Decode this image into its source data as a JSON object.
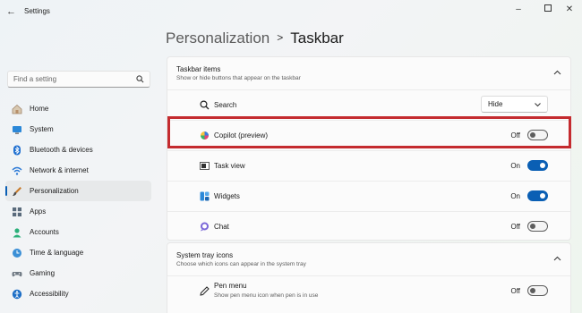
{
  "window": {
    "title": "Settings",
    "back_icon": "back-arrow-icon",
    "controls": {
      "minimize": "minimize-icon",
      "maximize": "maximize-icon",
      "close": "close-icon"
    }
  },
  "search": {
    "placeholder": "Find a setting",
    "value": "",
    "icon": "search-icon"
  },
  "sidebar": {
    "active_item": "Personalization",
    "items": [
      {
        "label": "Home",
        "icon": "home-icon"
      },
      {
        "label": "System",
        "icon": "monitor-icon"
      },
      {
        "label": "Bluetooth & devices",
        "icon": "bluetooth-icon"
      },
      {
        "label": "Network & internet",
        "icon": "wifi-icon"
      },
      {
        "label": "Personalization",
        "icon": "brush-icon"
      },
      {
        "label": "Apps",
        "icon": "apps-icon"
      },
      {
        "label": "Accounts",
        "icon": "person-icon"
      },
      {
        "label": "Time & language",
        "icon": "globe-clock-icon"
      },
      {
        "label": "Gaming",
        "icon": "gamepad-icon"
      },
      {
        "label": "Accessibility",
        "icon": "accessibility-icon"
      }
    ]
  },
  "breadcrumb": {
    "parent": "Personalization",
    "separator": ">",
    "current": "Taskbar"
  },
  "taskbar_items": {
    "title": "Taskbar items",
    "subtitle": "Show or hide buttons that appear on the taskbar",
    "expanded": true,
    "rows": [
      {
        "label": "Search",
        "icon": "search-icon",
        "control": "dropdown",
        "value": "Hide"
      },
      {
        "label": "Copilot (preview)",
        "icon": "copilot-icon",
        "control": "toggle",
        "state_label": "Off",
        "on": false,
        "highlighted": true
      },
      {
        "label": "Task view",
        "icon": "task-view-icon",
        "control": "toggle",
        "state_label": "On",
        "on": true
      },
      {
        "label": "Widgets",
        "icon": "widgets-icon",
        "control": "toggle",
        "state_label": "On",
        "on": true
      },
      {
        "label": "Chat",
        "icon": "chat-icon",
        "control": "toggle",
        "state_label": "Off",
        "on": false
      }
    ]
  },
  "system_tray": {
    "title": "System tray icons",
    "subtitle": "Choose which icons can appear in the system tray",
    "expanded": true,
    "rows": [
      {
        "label": "Pen menu",
        "sublabel": "Show pen menu icon when pen is in use",
        "icon": "pen-icon",
        "control": "toggle",
        "state_label": "Off",
        "on": false
      }
    ]
  },
  "colors": {
    "accent": "#0a5fb4",
    "highlight_box": "#c42b2f"
  }
}
